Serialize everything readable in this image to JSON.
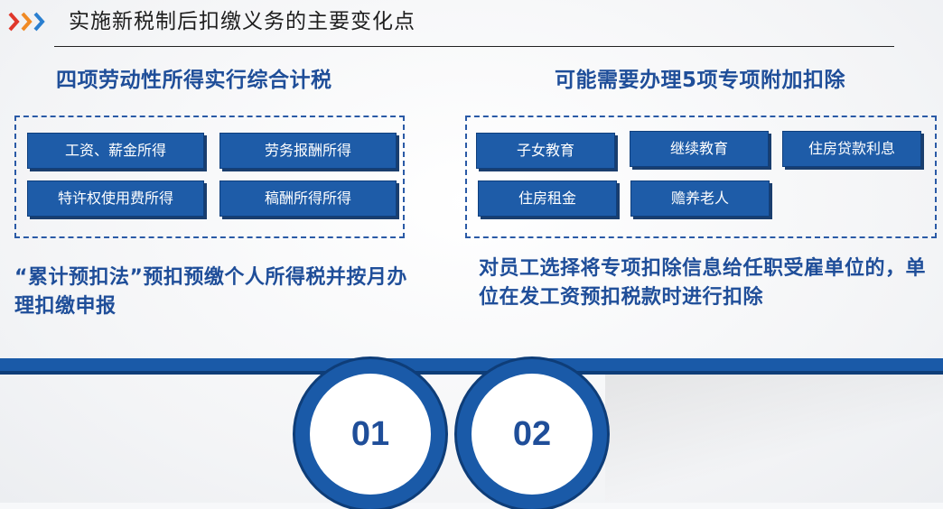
{
  "header": {
    "title": "实施新税制后扣缴义务的主要变化点",
    "icon_colors": [
      "#e0372b",
      "#f08a24",
      "#2a7fd0"
    ]
  },
  "left": {
    "title": "四项劳动性所得实行综合计税",
    "tags": [
      "工资、薪金所得",
      "劳务报酬所得",
      "特许权使用费所得",
      "稿酬所得所得"
    ],
    "description": "“累计预扣法”预扣预缴个人所得税并按月办理扣缴申报",
    "number": "01"
  },
  "right": {
    "title": "可能需要办理5项专项附加扣除",
    "tags": [
      "子女教育",
      "继续教育",
      "住房贷款利息",
      "住房租金",
      "赡养老人"
    ],
    "description": "对员工选择将专项扣除信息给任职受雇单位的，单位在发工资预扣税款时进行扣除",
    "number": "02"
  },
  "colors": {
    "accent_blue": "#1e5ca8",
    "title_blue": "#1f4e99"
  }
}
